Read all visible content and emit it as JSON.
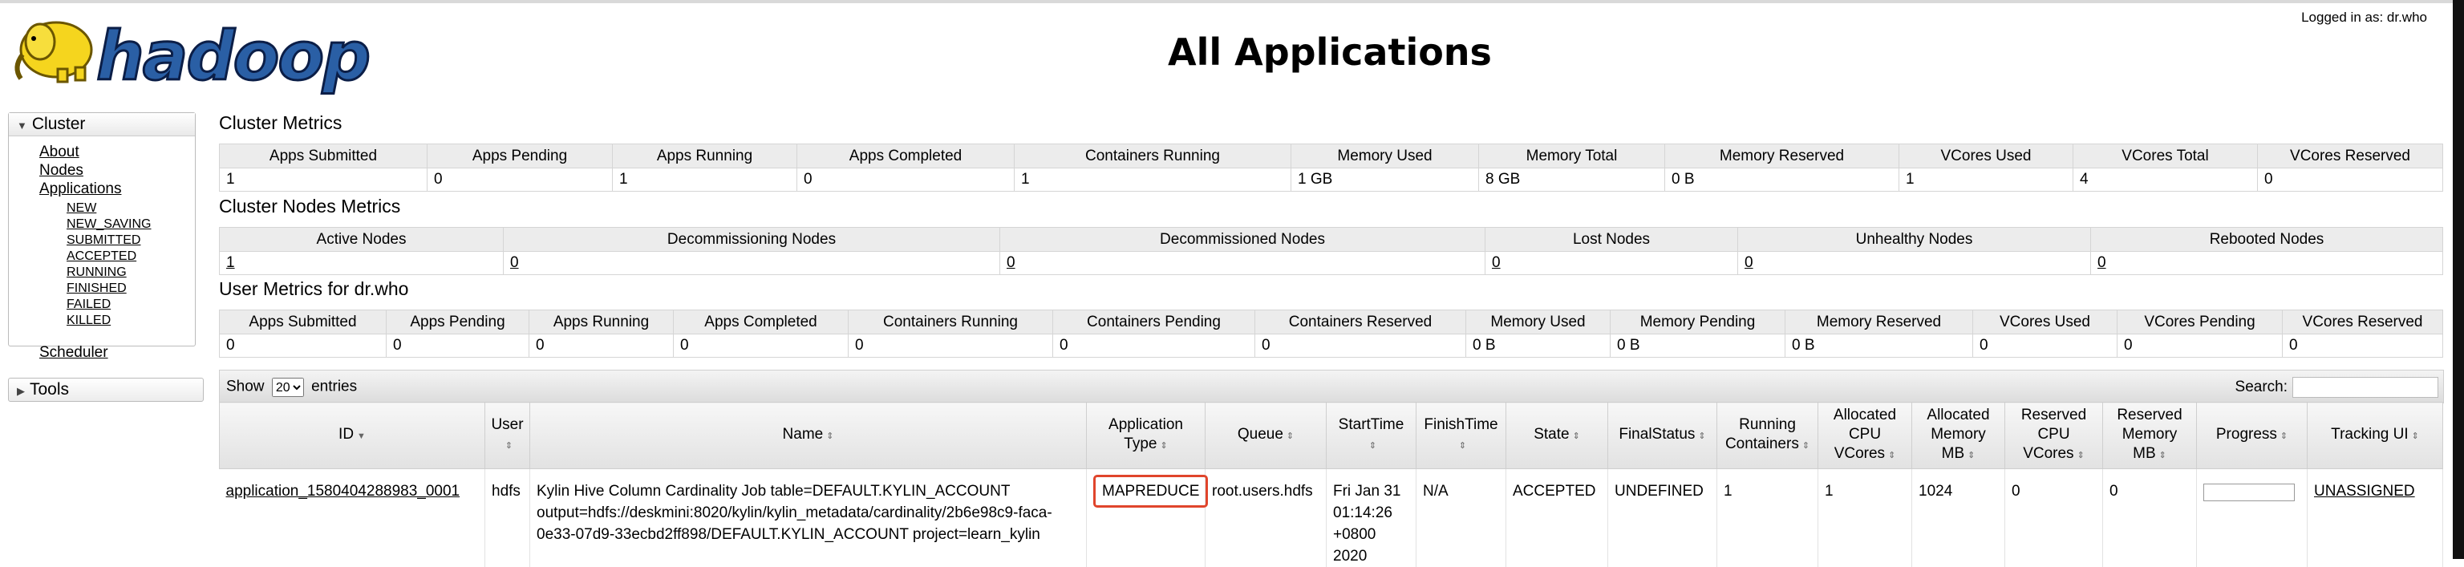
{
  "header": {
    "logo_text": "hadoop",
    "title": "All Applications",
    "logged_in": "Logged in as: dr.who"
  },
  "sidebar": {
    "cluster_label": "Cluster",
    "links": [
      "About",
      "Nodes",
      "Applications"
    ],
    "app_states": [
      "NEW",
      "NEW_SAVING",
      "SUBMITTED",
      "ACCEPTED",
      "RUNNING",
      "FINISHED",
      "FAILED",
      "KILLED"
    ],
    "scheduler": "Scheduler",
    "tools_label": "Tools"
  },
  "cluster_metrics": {
    "title": "Cluster Metrics",
    "headers": [
      "Apps Submitted",
      "Apps Pending",
      "Apps Running",
      "Apps Completed",
      "Containers Running",
      "Memory Used",
      "Memory Total",
      "Memory Reserved",
      "VCores Used",
      "VCores Total",
      "VCores Reserved"
    ],
    "values": [
      "1",
      "0",
      "1",
      "0",
      "1",
      "1 GB",
      "8 GB",
      "0 B",
      "1",
      "4",
      "0"
    ]
  },
  "nodes_metrics": {
    "title": "Cluster Nodes Metrics",
    "headers": [
      "Active Nodes",
      "Decommissioning Nodes",
      "Decommissioned Nodes",
      "Lost Nodes",
      "Unhealthy Nodes",
      "Rebooted Nodes"
    ],
    "values": [
      "1",
      "0",
      "0",
      "0",
      "0",
      "0"
    ]
  },
  "user_metrics": {
    "title": "User Metrics for dr.who",
    "headers": [
      "Apps Submitted",
      "Apps Pending",
      "Apps Running",
      "Apps Completed",
      "Containers Running",
      "Containers Pending",
      "Containers Reserved",
      "Memory Used",
      "Memory Pending",
      "Memory Reserved",
      "VCores Used",
      "VCores Pending",
      "VCores Reserved"
    ],
    "values": [
      "0",
      "0",
      "0",
      "0",
      "0",
      "0",
      "0",
      "0 B",
      "0 B",
      "0 B",
      "0",
      "0",
      "0"
    ]
  },
  "table_controls": {
    "show_label": "Show",
    "entries_value": "20",
    "entries_label": "entries",
    "search_label": "Search:"
  },
  "apps_table": {
    "headers": [
      "ID",
      "User",
      "Name",
      "Application Type",
      "Queue",
      "StartTime",
      "FinishTime",
      "State",
      "FinalStatus",
      "Running Containers",
      "Allocated CPU VCores",
      "Allocated Memory MB",
      "Reserved CPU VCores",
      "Reserved Memory MB",
      "Progress",
      "Tracking UI"
    ],
    "rows": [
      {
        "id": "application_1580404288983_0001",
        "user": "hdfs",
        "name": "Kylin Hive Column Cardinality Job table=DEFAULT.KYLIN_ACCOUNT output=hdfs://deskmini:8020/kylin/kylin_metadata/cardinality/2b6e98c9-faca-0e33-07d9-33ecbd2ff898/DEFAULT.KYLIN_ACCOUNT project=learn_kylin",
        "type": "MAPREDUCE",
        "queue": "root.users.hdfs",
        "start_time": "Fri Jan 31 01:14:26 +0800 2020",
        "finish_time": "N/A",
        "state": "ACCEPTED",
        "final_status": "UNDEFINED",
        "running_containers": "1",
        "alloc_vcores": "1",
        "alloc_mem": "1024",
        "res_vcores": "0",
        "res_mem": "0",
        "tracking_ui": "UNASSIGNED"
      }
    ]
  }
}
